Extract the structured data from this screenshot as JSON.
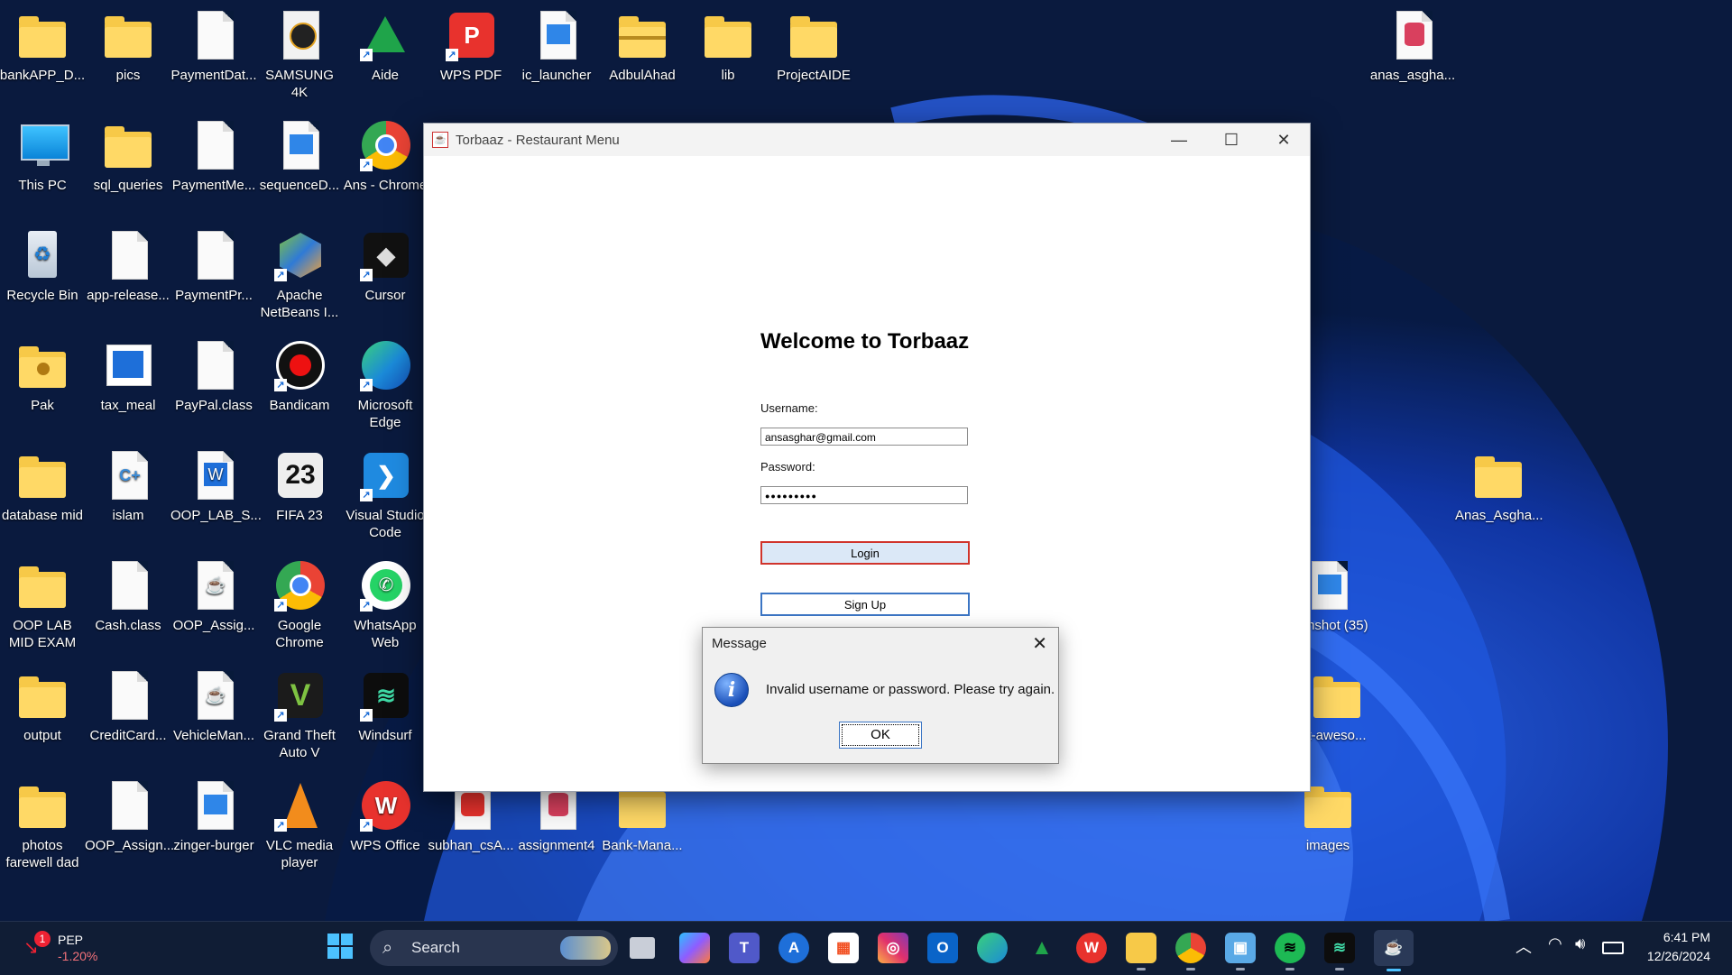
{
  "desktop": {
    "icons": [
      {
        "label": "bankAPP_D...",
        "icon": "folder-icon"
      },
      {
        "label": "pics",
        "icon": "folder-icon"
      },
      {
        "label": "PaymentDat...",
        "icon": "file-icon"
      },
      {
        "label": "SAMSUNG 4K",
        "icon": "samsung-4k-icon"
      },
      {
        "label": "Aide",
        "icon": "aide-icon"
      },
      {
        "label": "WPS PDF",
        "icon": "wps-pdf-icon"
      },
      {
        "label": "ic_launcher",
        "icon": "image-file-icon"
      },
      {
        "label": "AdbulAhad",
        "icon": "zip-folder-icon"
      },
      {
        "label": "lib",
        "icon": "folder-icon"
      },
      {
        "label": "ProjectAIDE",
        "icon": "folder-icon"
      },
      {
        "label": "anas_asgha...",
        "icon": "database-file-icon"
      },
      {
        "label": "This PC",
        "icon": "this-pc-icon"
      },
      {
        "label": "sql_queries",
        "icon": "folder-icon"
      },
      {
        "label": "PaymentMe...",
        "icon": "file-icon"
      },
      {
        "label": "sequenceD...",
        "icon": "image-file-icon"
      },
      {
        "label": "Ans - Chrome",
        "icon": "chrome-icon"
      },
      {
        "label": "Recycle Bin",
        "icon": "recycle-bin-icon"
      },
      {
        "label": "app-release...",
        "icon": "file-icon"
      },
      {
        "label": "PaymentPr...",
        "icon": "file-icon"
      },
      {
        "label": "Apache NetBeans I...",
        "icon": "netbeans-icon"
      },
      {
        "label": "Cursor",
        "icon": "cursor-icon"
      },
      {
        "label": "Pak",
        "icon": "user-folder-icon"
      },
      {
        "label": "tax_meal",
        "icon": "image-file-icon"
      },
      {
        "label": "PayPal.class",
        "icon": "file-icon"
      },
      {
        "label": "Bandicam",
        "icon": "bandicam-icon"
      },
      {
        "label": "Microsoft Edge",
        "icon": "edge-icon"
      },
      {
        "label": "database mid",
        "icon": "folder-icon"
      },
      {
        "label": "islam",
        "icon": "cpp-file-icon"
      },
      {
        "label": "OOP_LAB_S...",
        "icon": "word-file-icon"
      },
      {
        "label": "FIFA 23",
        "icon": "fifa-icon"
      },
      {
        "label": "Visual Studio Code",
        "icon": "vscode-icon"
      },
      {
        "label": "Anas_Asgha...",
        "icon": "folder-icon"
      },
      {
        "label": "OOP LAB MID EXAM",
        "icon": "folder-icon"
      },
      {
        "label": "Cash.class",
        "icon": "file-icon"
      },
      {
        "label": "OOP_Assig...",
        "icon": "java-file-icon"
      },
      {
        "label": "Google Chrome",
        "icon": "chrome-icon"
      },
      {
        "label": "WhatsApp Web",
        "icon": "whatsapp-icon"
      },
      {
        "label": "reenshot (35)",
        "icon": "image-file-icon"
      },
      {
        "label": "output",
        "icon": "folder-icon"
      },
      {
        "label": "CreditCard...",
        "icon": "file-icon"
      },
      {
        "label": "VehicleMan...",
        "icon": "java-file-icon"
      },
      {
        "label": "Grand Theft Auto V",
        "icon": "gta-icon"
      },
      {
        "label": "Windsurf",
        "icon": "windsurf-icon"
      },
      {
        "label": "t-aweso...",
        "icon": "folder-icon"
      },
      {
        "label": "photos farewell dad",
        "icon": "folder-icon"
      },
      {
        "label": "OOP_Assign...",
        "icon": "file-icon"
      },
      {
        "label": "zinger-burger",
        "icon": "image-file-icon"
      },
      {
        "label": "VLC media player",
        "icon": "vlc-icon"
      },
      {
        "label": "WPS Office",
        "icon": "wps-office-icon"
      },
      {
        "label": "subhan_csA...",
        "icon": "wps-pdf-icon"
      },
      {
        "label": "assignment4",
        "icon": "database-file-icon"
      },
      {
        "label": "Bank-Mana...",
        "icon": "folder-icon"
      },
      {
        "label": "images",
        "icon": "folder-icon"
      }
    ]
  },
  "window": {
    "title": "Torbaaz - Restaurant Menu",
    "heading": "Welcome to Torbaaz",
    "username_label": "Username:",
    "username_value": "ansasghar@gmail.com",
    "password_label": "Password:",
    "password_value": "●●●●●●●●●",
    "login_label": "Login",
    "signup_label": "Sign Up",
    "minimize_glyph": "—",
    "maximize_glyph": "☐",
    "close_glyph": "✕"
  },
  "dialog": {
    "title": "Message",
    "message": "Invalid username or password. Please try again.",
    "ok_label": "OK",
    "close_glyph": "✕",
    "info_glyph": "i"
  },
  "taskbar": {
    "weather_symbol": "PEP",
    "weather_change": "-1.20%",
    "notification_count": "1",
    "search_label": "Search",
    "apps": [
      "task-view-icon",
      "copilot-icon",
      "teams-icon",
      "store-icon",
      "microsoft-store-icon",
      "instagram-icon",
      "outlook-icon",
      "edge-icon",
      "aide-icon",
      "wps-office-icon",
      "file-explorer-icon",
      "chrome-icon",
      "photos-icon",
      "spotify-icon",
      "windsurf-icon",
      "java-icon"
    ],
    "time": "6:41 PM",
    "date": "12/26/2024"
  },
  "colors": {
    "accent": "#3b75c4",
    "taskbar": "#101d35",
    "folder": "#f7c948"
  }
}
